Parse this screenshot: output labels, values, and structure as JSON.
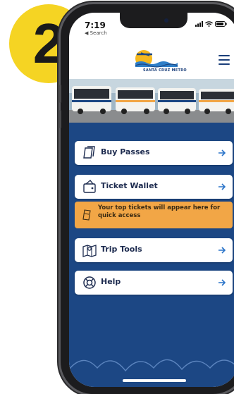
{
  "step_badge": {
    "number": "2",
    "color": "#f5d423"
  },
  "status_bar": {
    "time": "7:19",
    "back_label": "◀ Search",
    "icons": [
      "signal-icon",
      "wifi-icon",
      "battery-icon"
    ]
  },
  "header": {
    "logo_name": "metro-logo-icon",
    "logo_text": "SANTA CRUZ METRO",
    "menu_icon": "hamburger-menu-icon"
  },
  "hero": {
    "image_name": "bus-fleet-photo"
  },
  "menu": {
    "items": [
      {
        "label": "Buy Passes",
        "icon": "ticket-icon"
      },
      {
        "label": "Ticket Wallet",
        "icon": "wallet-icon"
      },
      {
        "label": "Trip Tools",
        "icon": "map-icon"
      },
      {
        "label": "Help",
        "icon": "lifebuoy-icon"
      }
    ]
  },
  "notice": {
    "text": "Your top tickets will appear here for quick access",
    "icon": "ticket-icon"
  },
  "colors": {
    "primary": "#1c4784",
    "accent": "#f2a646",
    "card": "#ffffff",
    "arrow": "#2a74c9"
  }
}
